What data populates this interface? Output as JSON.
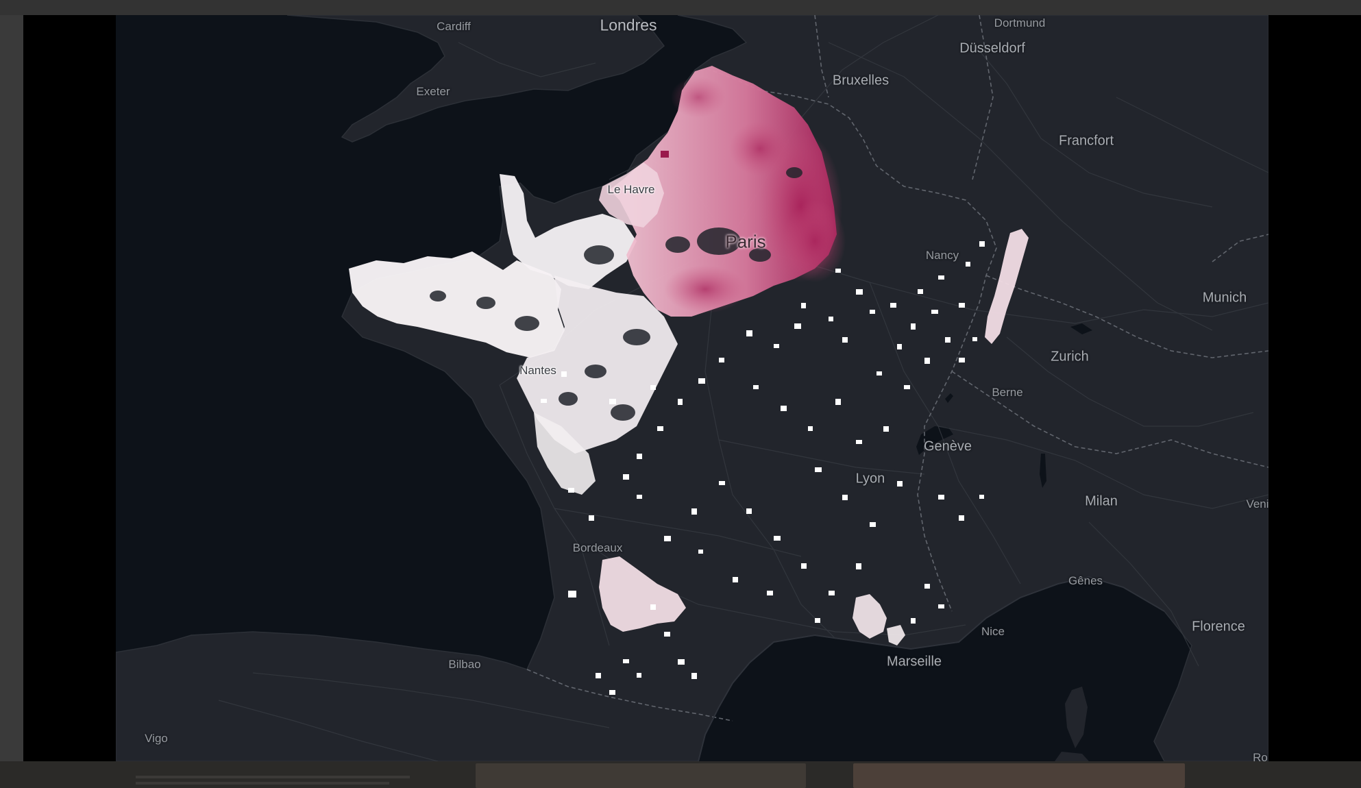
{
  "map": {
    "basemap_style": "dark",
    "colors": {
      "sea": "#0d1219",
      "land": "#22252c",
      "roads": "#34383f",
      "borders": "#5a5e66",
      "data_low": "#ffffff",
      "data_mid": "#e8a9c0",
      "data_high": "#b4245e",
      "frame": "#000000"
    },
    "cities": {
      "londres": "Londres",
      "cardiff": "Cardiff",
      "exeter": "Exeter",
      "dortmund": "Dortmund",
      "dusseldorf": "Düsseldorf",
      "bruxelles": "Bruxelles",
      "francfort": "Francfort",
      "le_havre": "Le Havre",
      "paris": "Paris",
      "nancy": "Nancy",
      "munich": "Munich",
      "zurich": "Zurich",
      "nantes": "Nantes",
      "berne": "Berne",
      "geneve": "Genève",
      "lyon": "Lyon",
      "milan": "Milan",
      "venise": "Veni",
      "bordeaux": "Bordeaux",
      "genes": "Gênes",
      "florence": "Florence",
      "nice": "Nice",
      "marseille": "Marseille",
      "bilbao": "Bilbao",
      "vigo": "Vigo",
      "rome": "Ro"
    }
  }
}
